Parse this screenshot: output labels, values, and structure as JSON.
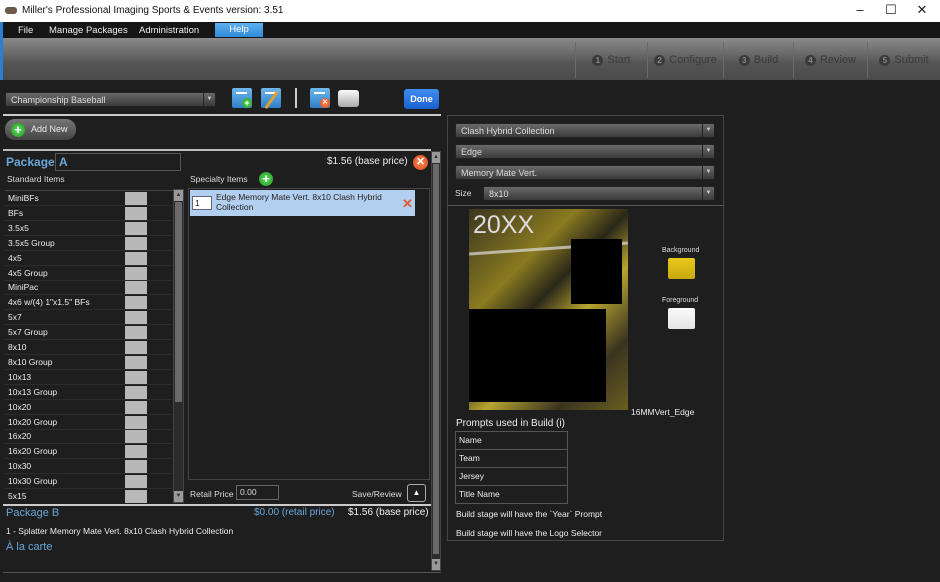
{
  "window": {
    "title": "Miller's Professional Imaging Sports & Events version: 3.51"
  },
  "menu": {
    "file": "File",
    "manage": "Manage Packages",
    "admin": "Administration",
    "help": "Help"
  },
  "steps": [
    {
      "n": "1",
      "label": "Start"
    },
    {
      "n": "2",
      "label": "Configure"
    },
    {
      "n": "3",
      "label": "Build"
    },
    {
      "n": "4",
      "label": "Review"
    },
    {
      "n": "5",
      "label": "Submit"
    }
  ],
  "toolbar": {
    "package_set": "Championship Baseball",
    "done": "Done",
    "add_new": "Add New"
  },
  "packageA": {
    "label": "Package",
    "name": "A",
    "base_price": "$1.56 (base price)",
    "standard_header": "Standard Items",
    "specialty_header": "Specialty Items",
    "standard_items": [
      "MiniBFs",
      "BFs",
      "3.5x5",
      "3.5x5 Group",
      "4x5",
      "4x5 Group",
      "MiniPac",
      "4x6 w/(4) 1\"x1.5\" BFs",
      "5x7",
      "5x7 Group",
      "8x10",
      "8x10 Group",
      "10x13",
      "10x13 Group",
      "10x20",
      "10x20 Group",
      "16x20",
      "16x20 Group",
      "10x30",
      "10x30 Group",
      "5x15"
    ],
    "specialty_item": {
      "qty": "1",
      "name": "Edge Memory Mate Vert. 8x10 Clash Hybrid Collection"
    },
    "retail_label": "Retail Price",
    "retail_value": "0.00",
    "save_review": "Save/Review"
  },
  "packageB": {
    "title": "Package B",
    "retail": "$0.00 (retail price)",
    "base": "$1.56 (base price)",
    "item": "1 - Splatter Memory Mate Vert. 8x10 Clash Hybrid Collection"
  },
  "alacarte": "À la carte",
  "config": {
    "collection": "Clash Hybrid Collection",
    "style": "Edge",
    "product": "Memory Mate Vert.",
    "size_label": "Size",
    "size": "8x10",
    "preview_text": "20XX",
    "template_name": "16MMVert_Edge",
    "background_label": "Background",
    "background_color": "#e8c81a",
    "foreground_label": "Foreground",
    "foreground_color": "#e4e4e4",
    "prompts_title": "Prompts used in Build (i)",
    "prompts": [
      "Name",
      "Team",
      "Jersey",
      "Title Name"
    ],
    "note_year": "Build stage will have the `Year` Prompt",
    "note_logo": "Build stage will have the Logo Selector"
  }
}
